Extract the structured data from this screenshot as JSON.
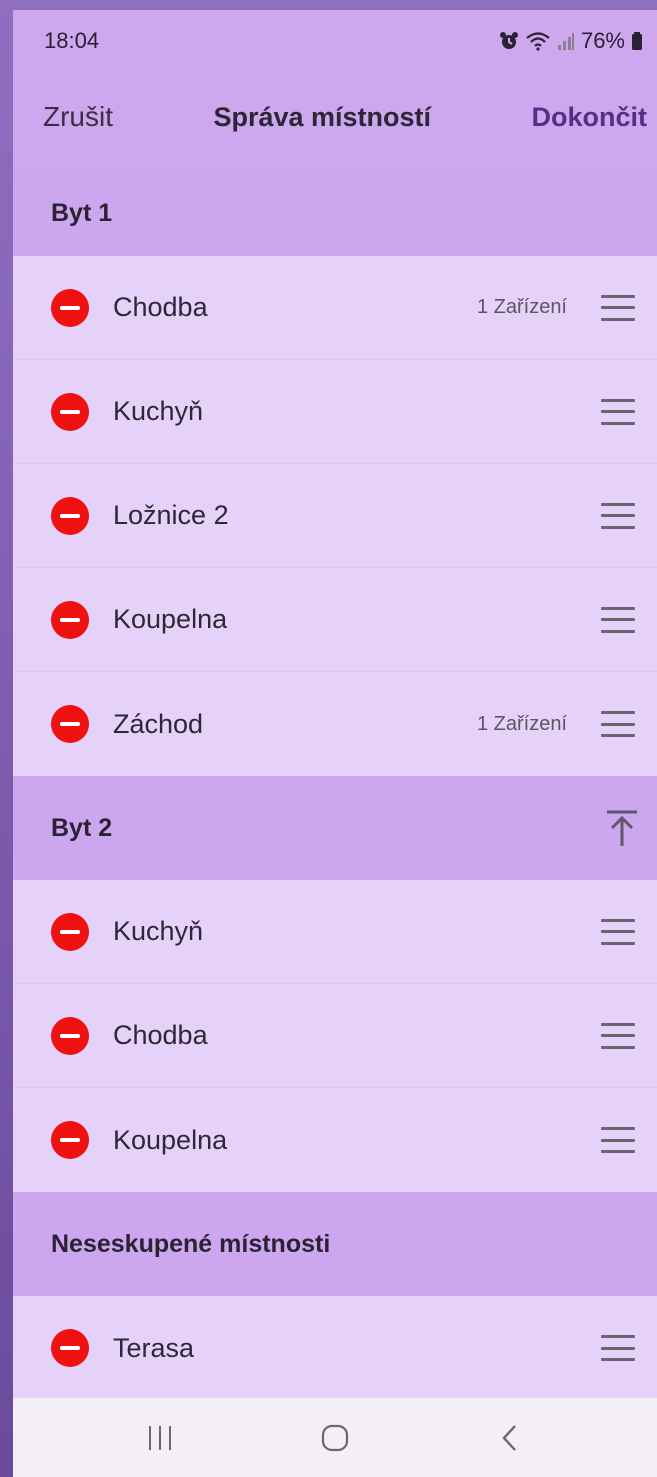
{
  "status": {
    "time": "18:04",
    "battery": "76%"
  },
  "header": {
    "cancel": "Zrušit",
    "title": "Správa místností",
    "done": "Dokončit"
  },
  "sections": [
    {
      "title": "Byt 1",
      "rooms": [
        {
          "name": "Chodba",
          "devices": "1 Zařízení"
        },
        {
          "name": "Kuchyň",
          "devices": ""
        },
        {
          "name": "Ložnice 2",
          "devices": ""
        },
        {
          "name": "Koupelna",
          "devices": ""
        },
        {
          "name": "Záchod",
          "devices": "1 Zařízení"
        }
      ]
    },
    {
      "title": "Byt 2",
      "rooms": [
        {
          "name": "Kuchyň",
          "devices": ""
        },
        {
          "name": "Chodba",
          "devices": ""
        },
        {
          "name": "Koupelna",
          "devices": ""
        }
      ]
    },
    {
      "title": "Neseskupené místnosti",
      "rooms": [
        {
          "name": "Terasa",
          "devices": ""
        }
      ]
    }
  ],
  "icons": {
    "alarm": "alarm-icon",
    "wifi": "wifi-icon",
    "signal": "signal-icon",
    "battery": "battery-icon",
    "remove": "remove-icon",
    "drag": "drag-handle-icon",
    "move_top": "move-to-top-icon",
    "nav_recents": "recents-icon",
    "nav_home": "home-icon",
    "nav_back": "back-icon"
  },
  "colors": {
    "accent": "#5a2c86",
    "remove": "#ee1111",
    "section": "#cca6ee",
    "row": "#e6d2f8"
  }
}
